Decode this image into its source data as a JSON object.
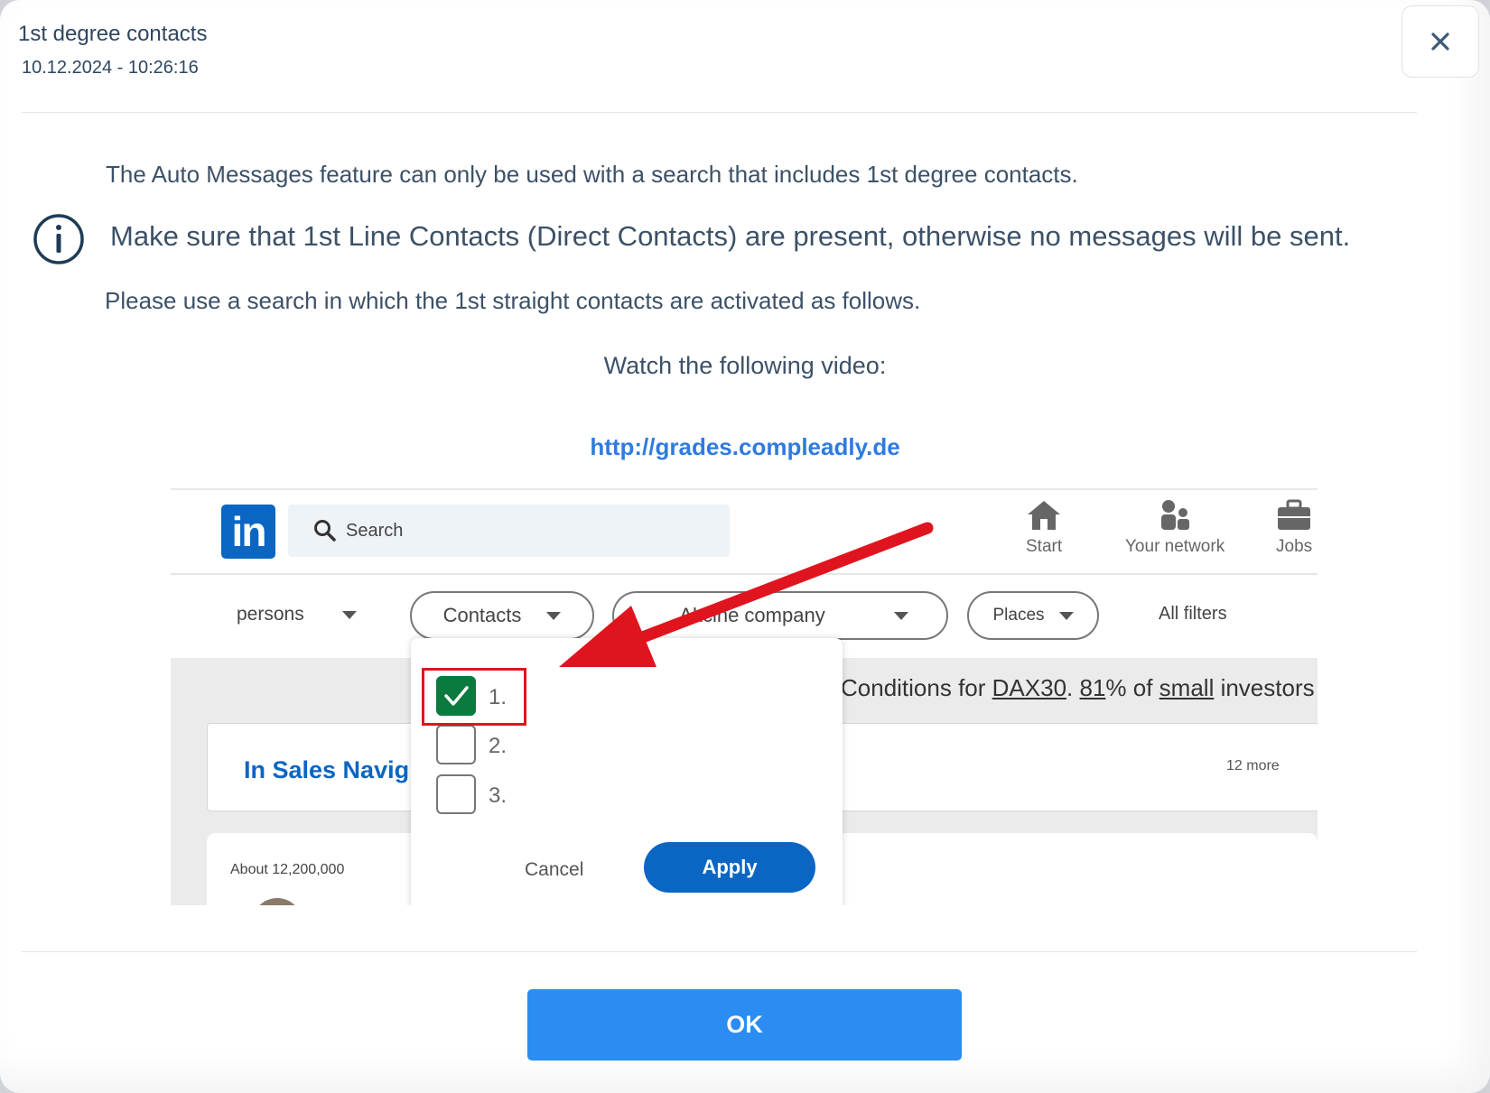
{
  "header": {
    "title": "1st degree contacts",
    "timestamp": "10.12.2024 - 10:26:16"
  },
  "body": {
    "line1": "The Auto Messages feature can only be used with a search that includes 1st degree contacts.",
    "line2": "Make sure that 1st Line Contacts (Direct Contacts) are present, otherwise no messages will be sent.",
    "line3": "Please use a search in which the 1st straight contacts are activated as follows.",
    "video_label": "Watch the following video:",
    "link": "http://grades.compleadly.de"
  },
  "screenshot": {
    "logo": "in",
    "search_placeholder": "Search",
    "nav": {
      "start": "Start",
      "network": "Your network",
      "jobs": "Jobs"
    },
    "filters": {
      "persons": "persons",
      "contacts": "Contacts",
      "company": "Akcine company",
      "places": "Places",
      "all_filters": "All filters"
    },
    "conditions_prefix": "Conditions for ",
    "conditions_dax": "DAX30",
    "conditions_mid": ". ",
    "conditions_pct": "81",
    "conditions_suffix": "% of ",
    "conditions_small": "small",
    "conditions_end": " investors",
    "sales_nav": "In Sales Navig",
    "more": "12 more",
    "about": "About 12,200,000",
    "options": [
      {
        "label": "1.",
        "checked": true
      },
      {
        "label": "2.",
        "checked": false
      },
      {
        "label": "3.",
        "checked": false
      }
    ],
    "cancel": "Cancel",
    "apply": "Apply"
  },
  "footer": {
    "ok": "OK"
  },
  "icons": {
    "close": "close-icon",
    "info": "info-circle-icon",
    "search": "search-icon",
    "home": "home-icon",
    "network": "people-icon",
    "jobs": "briefcase-icon",
    "check": "checkmark-icon",
    "arrow": "red-arrow-annotation"
  },
  "colors": {
    "text": "#3c5168",
    "link": "#2f7be0",
    "ok_button": "#2b8cf2",
    "linkedin_blue": "#0a66c2",
    "checked_green": "#0b7a3e",
    "annotation_red": "#e0141e"
  }
}
